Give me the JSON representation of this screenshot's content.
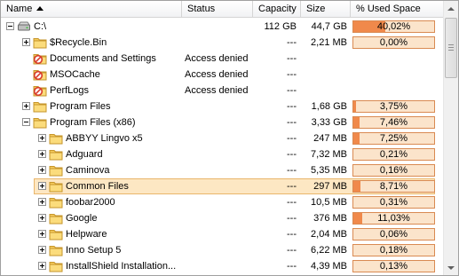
{
  "columns": {
    "name": "Name",
    "status": "Status",
    "capacity": "Capacity",
    "size": "Size",
    "used": "% Used Space"
  },
  "sort_icon": "sort-ascending-icon",
  "colors": {
    "bar_fill": "#f0894b",
    "bar_bg": "#fbe4cb",
    "selection": "#fde7c3"
  },
  "rows": [
    {
      "level": 0,
      "expander": "minus",
      "icon": "drive-icon",
      "name": "C:\\",
      "status": "",
      "capacity": "112 GB",
      "size": "44,7 GB",
      "pct": "40,02%",
      "fraction": 0.4002
    },
    {
      "level": 1,
      "expander": "plus",
      "icon": "folder-icon",
      "name": "$Recycle.Bin",
      "status": "",
      "capacity": "---",
      "size": "2,21 MB",
      "pct": "0,00%",
      "fraction": 0.0
    },
    {
      "level": 1,
      "expander": "none",
      "icon": "folder-denied-icon",
      "name": "Documents and Settings",
      "status": "Access denied",
      "capacity": "---",
      "size": "",
      "pct": "",
      "fraction": null
    },
    {
      "level": 1,
      "expander": "none",
      "icon": "folder-denied-icon",
      "name": "MSOCache",
      "status": "Access denied",
      "capacity": "---",
      "size": "",
      "pct": "",
      "fraction": null
    },
    {
      "level": 1,
      "expander": "none",
      "icon": "folder-denied-icon",
      "name": "PerfLogs",
      "status": "Access denied",
      "capacity": "---",
      "size": "",
      "pct": "",
      "fraction": null
    },
    {
      "level": 1,
      "expander": "plus",
      "icon": "folder-icon",
      "name": "Program Files",
      "status": "",
      "capacity": "---",
      "size": "1,68 GB",
      "pct": "3,75%",
      "fraction": 0.0375
    },
    {
      "level": 1,
      "expander": "minus",
      "icon": "folder-icon",
      "name": "Program Files (x86)",
      "status": "",
      "capacity": "---",
      "size": "3,33 GB",
      "pct": "7,46%",
      "fraction": 0.0746
    },
    {
      "level": 2,
      "expander": "plus",
      "icon": "folder-icon",
      "name": "ABBYY Lingvo x5",
      "status": "",
      "capacity": "---",
      "size": "247 MB",
      "pct": "7,25%",
      "fraction": 0.0725
    },
    {
      "level": 2,
      "expander": "plus",
      "icon": "folder-icon",
      "name": "Adguard",
      "status": "",
      "capacity": "---",
      "size": "7,32 MB",
      "pct": "0,21%",
      "fraction": 0.0021
    },
    {
      "level": 2,
      "expander": "plus",
      "icon": "folder-icon",
      "name": "Caminova",
      "status": "",
      "capacity": "---",
      "size": "5,35 MB",
      "pct": "0,16%",
      "fraction": 0.0016
    },
    {
      "level": 2,
      "expander": "plus",
      "icon": "folder-icon",
      "name": "Common Files",
      "status": "",
      "capacity": "---",
      "size": "297 MB",
      "pct": "8,71%",
      "fraction": 0.0871,
      "selected": true
    },
    {
      "level": 2,
      "expander": "plus",
      "icon": "folder-icon",
      "name": "foobar2000",
      "status": "",
      "capacity": "---",
      "size": "10,5 MB",
      "pct": "0,31%",
      "fraction": 0.0031
    },
    {
      "level": 2,
      "expander": "plus",
      "icon": "folder-icon",
      "name": "Google",
      "status": "",
      "capacity": "---",
      "size": "376 MB",
      "pct": "11,03%",
      "fraction": 0.1103
    },
    {
      "level": 2,
      "expander": "plus",
      "icon": "folder-icon",
      "name": "Helpware",
      "status": "",
      "capacity": "---",
      "size": "2,04 MB",
      "pct": "0,06%",
      "fraction": 0.0006
    },
    {
      "level": 2,
      "expander": "plus",
      "icon": "folder-icon",
      "name": "Inno Setup 5",
      "status": "",
      "capacity": "---",
      "size": "6,22 MB",
      "pct": "0,18%",
      "fraction": 0.0018
    },
    {
      "level": 2,
      "expander": "plus",
      "icon": "folder-icon",
      "name": "InstallShield  Installation...",
      "status": "",
      "capacity": "---",
      "size": "4,39 MB",
      "pct": "0,13%",
      "fraction": 0.0013
    }
  ]
}
